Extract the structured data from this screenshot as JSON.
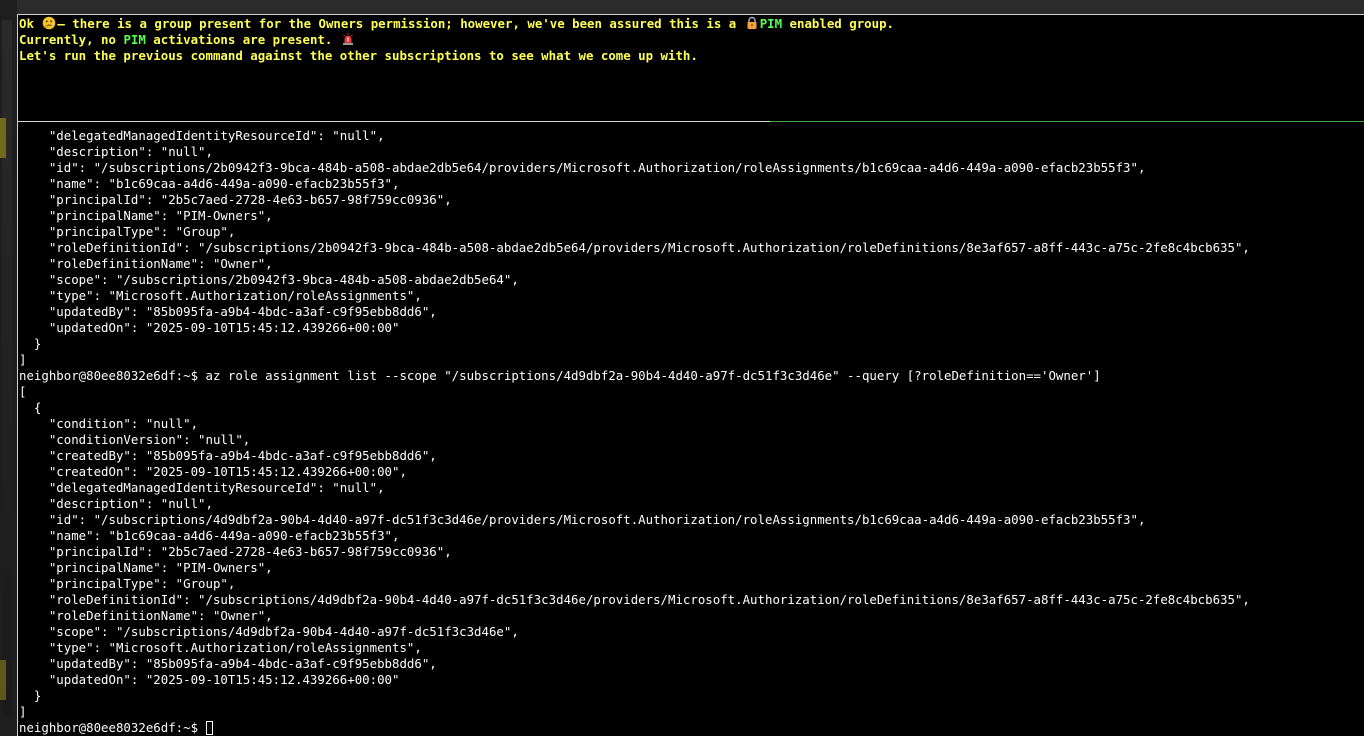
{
  "chat": {
    "line1_a": "Ok ",
    "line1_b": "— there is a group present for the Owners permission; however, we've been assured this is a ",
    "line1_pim": "PIM",
    "line1_c": " enabled group.",
    "line2_a": "Currently, no ",
    "line2_pim": "PIM",
    "line2_b": " activations are present. ",
    "line3": "Let's run the previous command against the other subscriptions to see what we come up with."
  },
  "icons": {
    "thinking": "thinking-face-icon",
    "lock": "lock-icon",
    "siren": "siren-icon"
  },
  "colors": {
    "chat_text": "#ffff55",
    "pim_highlight": "#55ff55",
    "terminal_bg": "#000000",
    "terminal_text": "#ffffff"
  },
  "terminal": {
    "lines": [
      "    \"delegatedManagedIdentityResourceId\": \"null\",",
      "    \"description\": \"null\",",
      "    \"id\": \"/subscriptions/2b0942f3-9bca-484b-a508-abdae2db5e64/providers/Microsoft.Authorization/roleAssignments/b1c69caa-a4d6-449a-a090-efacb23b55f3\",",
      "    \"name\": \"b1c69caa-a4d6-449a-a090-efacb23b55f3\",",
      "    \"principalId\": \"2b5c7aed-2728-4e63-b657-98f759cc0936\",",
      "    \"principalName\": \"PIM-Owners\",",
      "    \"principalType\": \"Group\",",
      "    \"roleDefinitionId\": \"/subscriptions/2b0942f3-9bca-484b-a508-abdae2db5e64/providers/Microsoft.Authorization/roleDefinitions/8e3af657-a8ff-443c-a75c-2fe8c4bcb635\",",
      "    \"roleDefinitionName\": \"Owner\",",
      "    \"scope\": \"/subscriptions/2b0942f3-9bca-484b-a508-abdae2db5e64\",",
      "    \"type\": \"Microsoft.Authorization/roleAssignments\",",
      "    \"updatedBy\": \"85b095fa-a9b4-4bdc-a3af-c9f95ebb8dd6\",",
      "    \"updatedOn\": \"2025-09-10T15:45:12.439266+00:00\"",
      "  }",
      "]",
      "neighbor@80ee8032e6df:~$ az role assignment list --scope \"/subscriptions/4d9dbf2a-90b4-4d40-a97f-dc51f3c3d46e\" --query [?roleDefinition=='Owner']",
      "[",
      "  {",
      "    \"condition\": \"null\",",
      "    \"conditionVersion\": \"null\",",
      "    \"createdBy\": \"85b095fa-a9b4-4bdc-a3af-c9f95ebb8dd6\",",
      "    \"createdOn\": \"2025-09-10T15:45:12.439266+00:00\",",
      "    \"delegatedManagedIdentityResourceId\": \"null\",",
      "    \"description\": \"null\",",
      "    \"id\": \"/subscriptions/4d9dbf2a-90b4-4d40-a97f-dc51f3c3d46e/providers/Microsoft.Authorization/roleAssignments/b1c69caa-a4d6-449a-a090-efacb23b55f3\",",
      "    \"name\": \"b1c69caa-a4d6-449a-a090-efacb23b55f3\",",
      "    \"principalId\": \"2b5c7aed-2728-4e63-b657-98f759cc0936\",",
      "    \"principalName\": \"PIM-Owners\",",
      "    \"principalType\": \"Group\",",
      "    \"roleDefinitionId\": \"/subscriptions/4d9dbf2a-90b4-4d40-a97f-dc51f3c3d46e/providers/Microsoft.Authorization/roleDefinitions/8e3af657-a8ff-443c-a75c-2fe8c4bcb635\",",
      "    \"roleDefinitionName\": \"Owner\",",
      "    \"scope\": \"/subscriptions/4d9dbf2a-90b4-4d40-a97f-dc51f3c3d46e\",",
      "    \"type\": \"Microsoft.Authorization/roleAssignments\",",
      "    \"updatedBy\": \"85b095fa-a9b4-4bdc-a3af-c9f95ebb8dd6\",",
      "    \"updatedOn\": \"2025-09-10T15:45:12.439266+00:00\"",
      "  }",
      "]"
    ],
    "prompt": "neighbor@80ee8032e6df:~$ "
  }
}
